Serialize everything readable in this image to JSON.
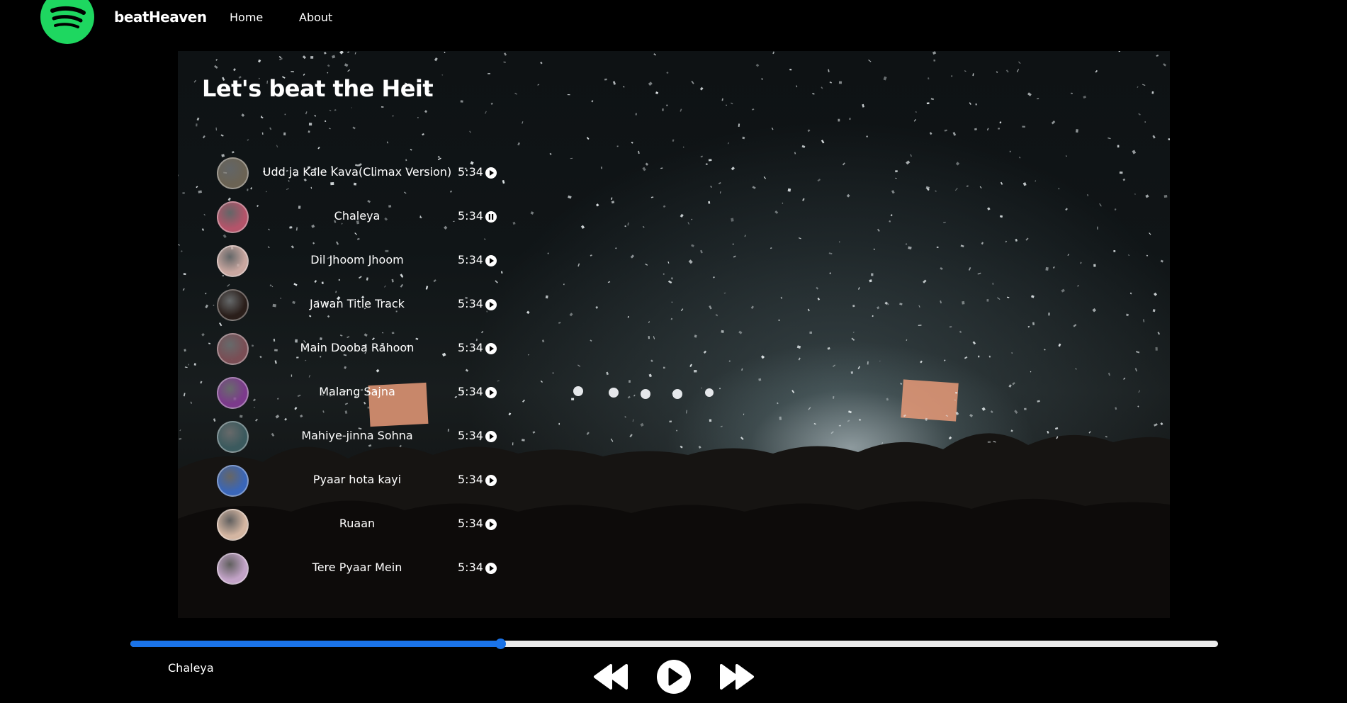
{
  "nav": {
    "brand": "beatHeaven",
    "links": [
      "Home",
      "About"
    ]
  },
  "page": {
    "title": "Let's beat the Heit"
  },
  "songs": [
    {
      "title": "Udd ja Kale Kava(Climax Version)",
      "duration": "5:34",
      "state": "play",
      "thumb_color": "#6b6354"
    },
    {
      "title": "Chaleya",
      "duration": "5:34",
      "state": "pause",
      "thumb_color": "#b4546a"
    },
    {
      "title": "Dil Jhoom Jhoom",
      "duration": "5:34",
      "state": "play",
      "thumb_color": "#c9a7a0"
    },
    {
      "title": "Jawan Title Track",
      "duration": "5:34",
      "state": "play",
      "thumb_color": "#2a1e1a"
    },
    {
      "title": "Main Dooba Rahoon",
      "duration": "5:34",
      "state": "play",
      "thumb_color": "#7a4e55"
    },
    {
      "title": "Malang Sajna",
      "duration": "5:34",
      "state": "play",
      "thumb_color": "#7c3a8c"
    },
    {
      "title": "Mahiye-jinna Sohna",
      "duration": "5:34",
      "state": "play",
      "thumb_color": "#3b5a5e"
    },
    {
      "title": "Pyaar hota kayi",
      "duration": "5:34",
      "state": "play",
      "thumb_color": "#3a66b8"
    },
    {
      "title": "Ruaan",
      "duration": "5:34",
      "state": "play",
      "thumb_color": "#d4b6a2"
    },
    {
      "title": "Tere Pyaar Mein",
      "duration": "5:34",
      "state": "play",
      "thumb_color": "#c2a3c7"
    }
  ],
  "player": {
    "now_playing": "Chaleya",
    "progress": 0.34,
    "icons": [
      "previous-icon",
      "play-icon",
      "next-icon"
    ]
  },
  "colors": {
    "accent_green": "#1ed760",
    "progress_blue": "#1a73e8",
    "background": "#000000"
  }
}
